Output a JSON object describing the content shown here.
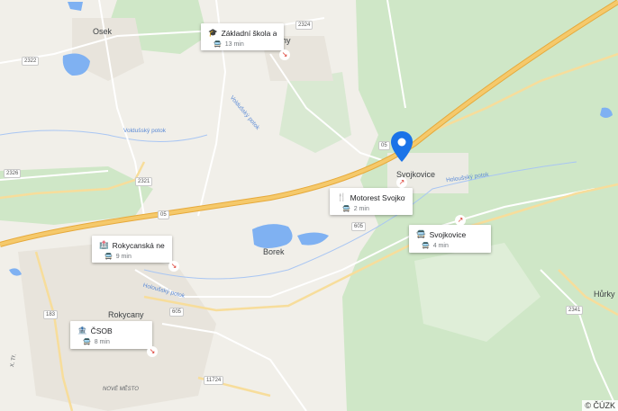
{
  "places": {
    "osek": "Osek",
    "svojkovice": "Svojkovice",
    "borek": "Borek",
    "rokycany": "Rokycany",
    "hurky": "Hůrky",
    "hy": "hy",
    "nove_mesto": "NOVÉ MĚSTO",
    "x_trida": "X. Tř."
  },
  "roads": {
    "r2324": "2324",
    "r2322": "2322",
    "r2326": "2326",
    "r2321": "2321",
    "r05a": "05",
    "r05b": "05",
    "r605a": "605",
    "r605b": "605",
    "r183": "183",
    "r2341": "2341",
    "r11724": "11724"
  },
  "water": {
    "volduchy": "Voldušský potok",
    "holous": "Holoušský potok",
    "holous2": "Holoušský potok",
    "volduch2": "Voldušský potok"
  },
  "cards": [
    {
      "title": "Základní škola a ...",
      "icon": "school-icon",
      "duration": "13 min",
      "mode": "bus-icon"
    },
    {
      "title": "Motorest Svojkovi...",
      "icon": "restaurant-icon",
      "duration": "2 min",
      "mode": "bus-icon"
    },
    {
      "title": "Svojkovice",
      "icon": "bus-icon",
      "duration": "4 min",
      "mode": "bus-icon"
    },
    {
      "title": "Rokycanská nemo...",
      "icon": "hospital-icon",
      "duration": "9 min",
      "mode": "bus-icon"
    },
    {
      "title": "ČSOB",
      "icon": "bank-icon",
      "duration": "8 min",
      "mode": "bus-icon"
    }
  ],
  "attribution": "© ČÚZK",
  "colors": {
    "background": "#f1efe9",
    "forest": "#cfe7c7",
    "water": "#7fb1f2",
    "highway": "#f5c96b",
    "pin": "#1a73e8",
    "arrow": "#d93025"
  }
}
